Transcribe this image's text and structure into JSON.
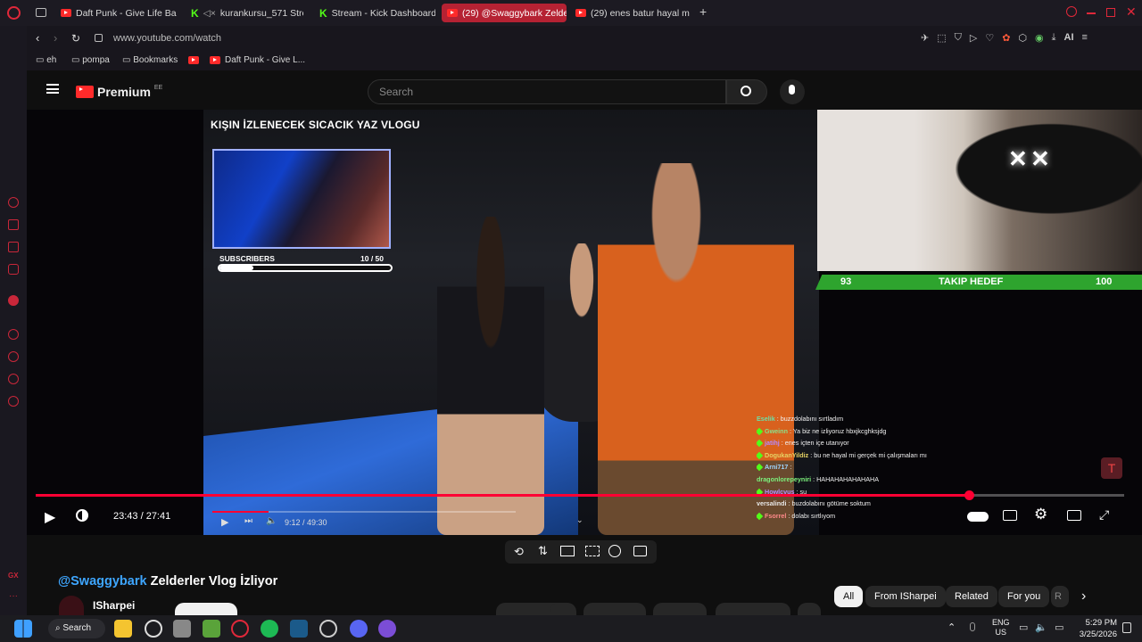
{
  "browser": {
    "tabs": [
      {
        "label": "Daft Punk - Give Life Back",
        "icon": "youtube-icon"
      },
      {
        "label": "kurankursu_571 Stream",
        "icon": "kick-icon"
      },
      {
        "label": "Stream - Kick Dashboard",
        "icon": "kick-icon"
      },
      {
        "label": "(29) @Swaggybark Zelder",
        "icon": "youtube-icon"
      },
      {
        "label": "(29) enes batur hayal mi g",
        "icon": "youtube-icon"
      }
    ],
    "url": "www.youtube.com/watch",
    "bookmarks": [
      "eh",
      "pompa",
      "Bookmarks",
      "Daft Punk - Give L..."
    ],
    "ai_label": "AI"
  },
  "youtube": {
    "logo_text": "Premium",
    "logo_superscript": "EE",
    "search_placeholder": "Search"
  },
  "video": {
    "overlay_title": "KIŞIN İZLENECEK SICACIK YAZ VLOGU",
    "subscribers_label": "SUBSCRIBERS",
    "subscribers_count": "10 / 50",
    "subscribers_progress": 0.2,
    "goal_left": "93",
    "goal_label": "TAKIP HEDEF",
    "goal_right": "100",
    "time": "23:43 / 27:41",
    "progress": 0.857,
    "inner_time": "9:12 / 49:30",
    "inner_progress": 0.186,
    "chat": [
      {
        "user": "Eselik",
        "msg": ": buzzdolabını sırtladım"
      },
      {
        "user": "Gweinn",
        "msg": ": Ya biz ne izliyoruz hbxjkcghksjdg"
      },
      {
        "user": "jatihj",
        "msg": ": enes içten içe utanıyor"
      },
      {
        "user": "DogukanYildiz",
        "msg": ": bu ne hayal mi gerçek mi çalışmaları mı"
      },
      {
        "user": "Arni717",
        "msg": ":"
      },
      {
        "user": "dragonlorepeyniri",
        "msg": ": HAHAHAHAHAHAHA"
      },
      {
        "user": "Howlcvus",
        "msg": ": su"
      },
      {
        "user": "versalindi",
        "msg": ": buzdolabını götüme soktum"
      },
      {
        "user": "Fsorrel",
        "msg": ": dolabı sırtlıyom"
      }
    ]
  },
  "page": {
    "title_mention": "@Swaggybark",
    "title_rest": " Zelderler Vlog İzliyor",
    "channel": "ISharpei",
    "chips": [
      "All",
      "From ISharpei",
      "Related",
      "For you",
      "R"
    ]
  },
  "taskbar": {
    "search_label": "Search",
    "lang_1": "ENG",
    "lang_2": "US",
    "time": "5:29 PM",
    "date": "3/25/2026"
  }
}
